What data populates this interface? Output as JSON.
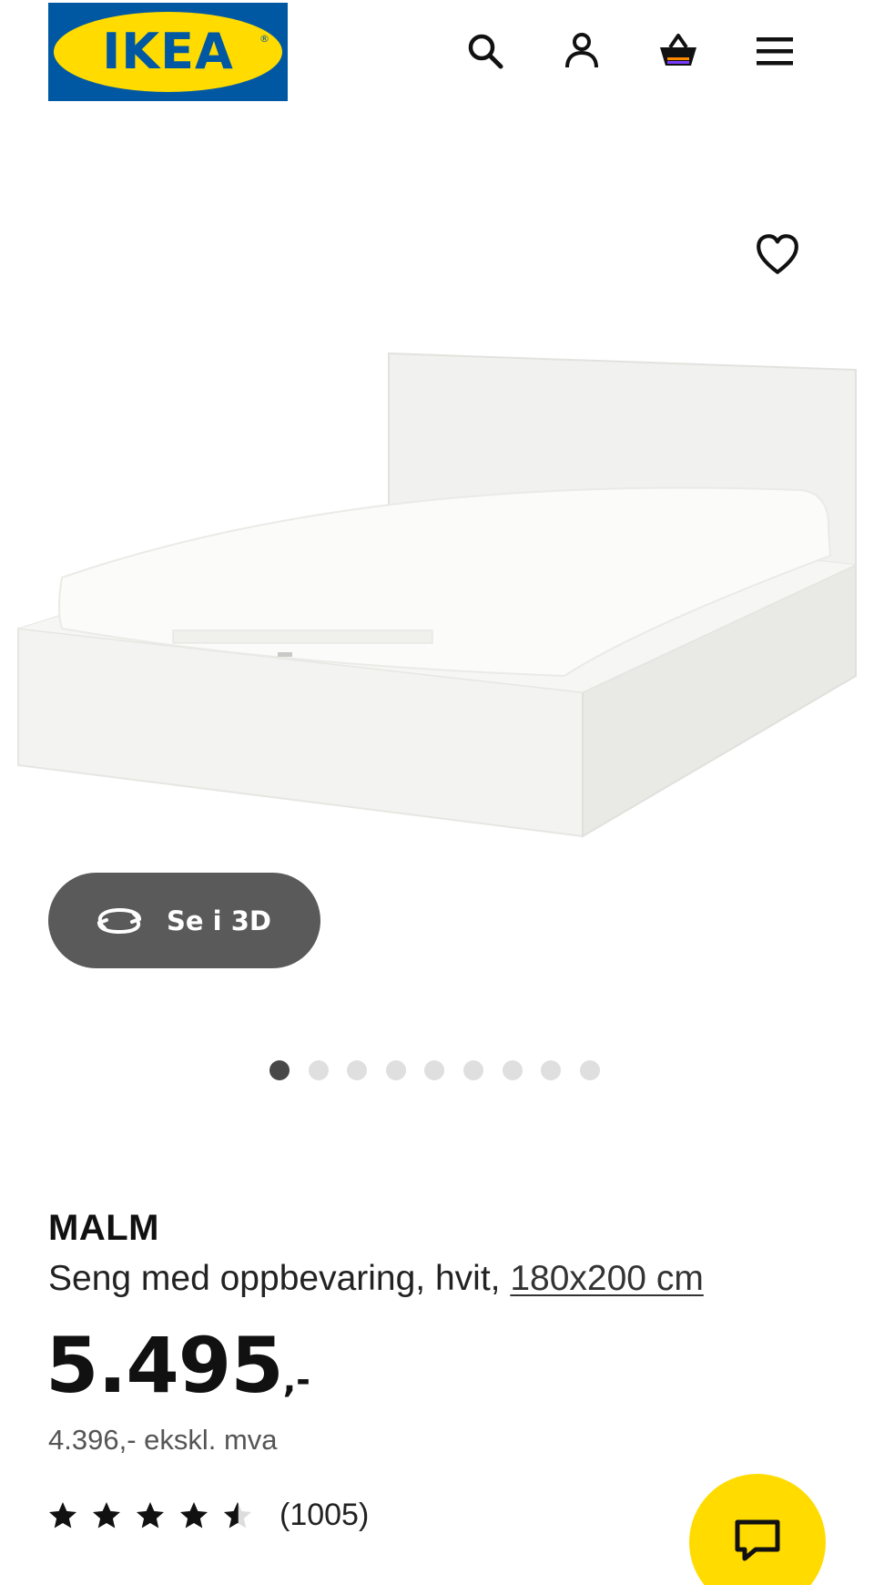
{
  "header": {
    "logo_text": "IKEA",
    "logo_mark": "®",
    "icons": [
      "search-icon",
      "account-icon",
      "shopping-basket-icon",
      "menu-icon"
    ]
  },
  "product": {
    "name": "MALM",
    "description": "Seng med oppbevaring, hvit,",
    "size_link": "180x200 cm",
    "price_main": "5.495",
    "price_suffix": ",-",
    "price_ex_vat": "4.396,- ekskl. mva",
    "rating": 4.5,
    "rating_max": 5,
    "review_count": "(1005)"
  },
  "gallery": {
    "view_3d_label": "Se i 3D",
    "image_count": 9,
    "active_index": 0
  },
  "colors": {
    "ikea_blue": "#0058a3",
    "ikea_yellow": "#ffdb00",
    "button_dark": "#5a5a5a"
  }
}
